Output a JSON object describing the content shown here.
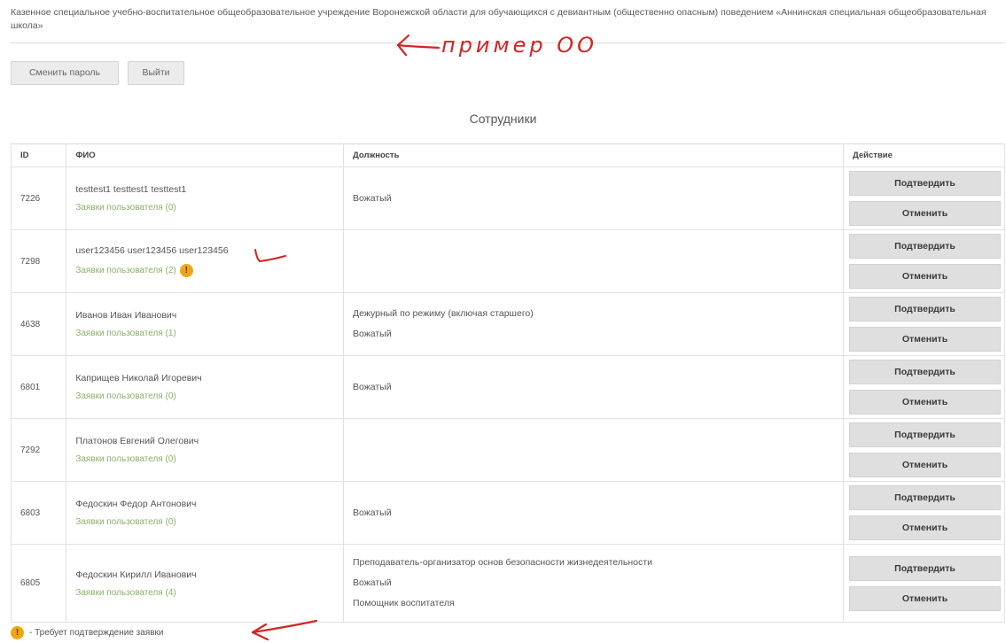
{
  "header": {
    "org_name": "Казенное специальное учебно-воспитательное общеобразовательное учреждение Воронежской области для обучающихся с девиантным (общественно опасным) поведением «Аннинская специальная общеобразовательная школа»",
    "change_password_label": "Сменить пароль",
    "logout_label": "Выйти"
  },
  "annotation": {
    "handwritten_note": "пример ОО",
    "color": "#d42424"
  },
  "staff": {
    "title": "Сотрудники",
    "columns": {
      "id": "ID",
      "name": "ФИО",
      "position": "Должность",
      "action": "Действие"
    },
    "confirm_label": "Подтвердить",
    "reject_label": "Отменить",
    "rows": [
      {
        "id": "7226",
        "name": "testtest1 testtest1 testtest1",
        "requests": "Заявки пользователя (0)",
        "positions": [
          "Вожатый"
        ],
        "pending": false
      },
      {
        "id": "7298",
        "name": "user123456 user123456 user123456",
        "requests": "Заявки пользователя (2)",
        "positions": [],
        "pending": true
      },
      {
        "id": "4638",
        "name": "Иванов Иван Иванович",
        "requests": "Заявки пользователя (1)",
        "positions": [
          "Дежурный по режиму (включая старшего)",
          "Вожатый"
        ],
        "pending": false
      },
      {
        "id": "6801",
        "name": "Каприщев Николай Игоревич",
        "requests": "Заявки пользователя (0)",
        "positions": [
          "Вожатый"
        ],
        "pending": false
      },
      {
        "id": "7292",
        "name": "Платонов Евгений Олегович",
        "requests": "Заявки пользователя (0)",
        "positions": [],
        "pending": false
      },
      {
        "id": "6803",
        "name": "Федоскин Федор Антонович",
        "requests": "Заявки пользователя (0)",
        "positions": [
          "Вожатый"
        ],
        "pending": false
      },
      {
        "id": "6805",
        "name": "Федоскин Кирилл Иванович",
        "requests": "Заявки пользователя (4)",
        "positions": [
          "Преподаватель-организатор основ безопасности жизнедеятельности",
          "Вожатый",
          "Помощник воспитателя"
        ],
        "pending": false
      }
    ]
  },
  "legend": {
    "badge_symbol": "!",
    "text": "- Требует подтверждение заявки",
    "badge_color": "#f0a614"
  },
  "colors": {
    "link": "#8bb06a",
    "button_bg": "#dfdfdf"
  }
}
